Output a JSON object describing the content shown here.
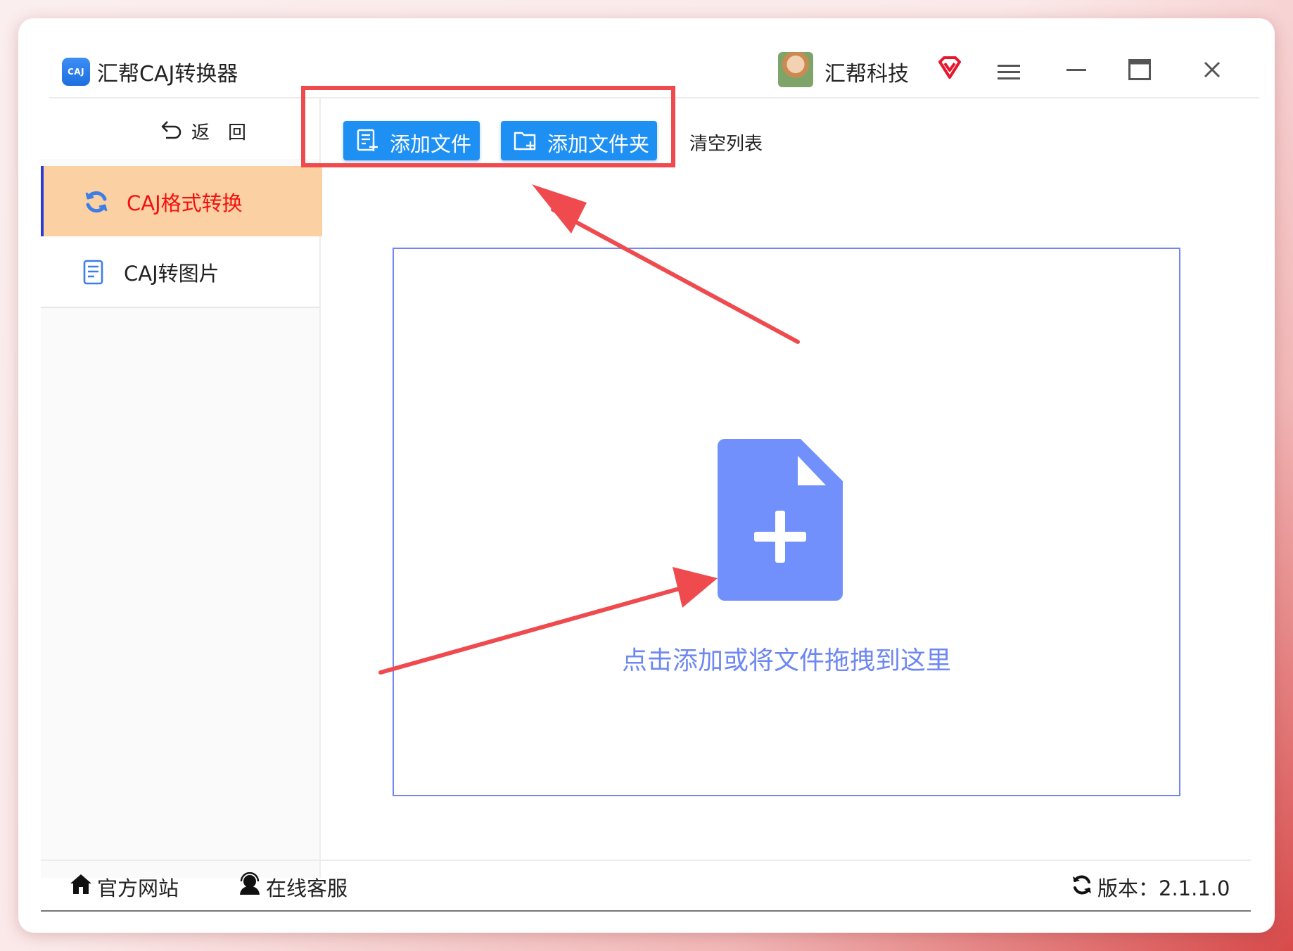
{
  "app": {
    "logo_text": "CAJ",
    "title": "汇帮CAJ转换器"
  },
  "user": {
    "name": "汇帮科技"
  },
  "sidebar": {
    "back_label": "返回",
    "items": [
      {
        "label": "CAJ格式转换",
        "active": true
      },
      {
        "label": "CAJ转图片",
        "active": false
      }
    ]
  },
  "toolbar": {
    "add_file_label": "添加文件",
    "add_folder_label": "添加文件夹",
    "clear_label": "清空列表"
  },
  "drop_zone": {
    "hint": "点击添加或将文件拖拽到这里"
  },
  "footer": {
    "website_label": "官方网站",
    "service_label": "在线客服",
    "version_label": "版本：2.1.1.0"
  },
  "colors": {
    "primary_blue": "#1e90f4",
    "active_nav_bg": "#fbd0a2",
    "active_nav_text": "#f41010",
    "drop_zone_border": "#7185f4",
    "annotation_red": "#ef4b4f"
  }
}
